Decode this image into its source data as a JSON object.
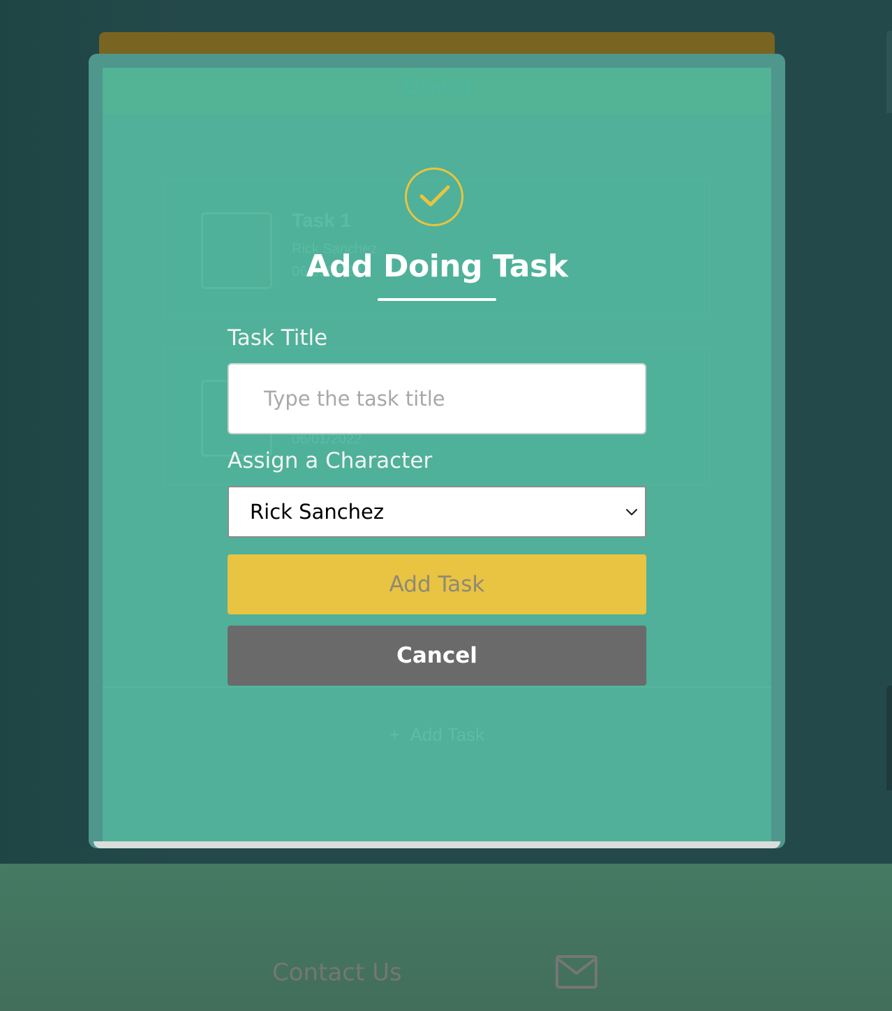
{
  "board": {
    "column_title": "Doing",
    "cards": [
      {
        "title": "Task 1",
        "character": "Rick Sanchez",
        "date": "06/01/2022"
      },
      {
        "title": "",
        "character": "",
        "date": "06/01/2022"
      }
    ],
    "add_task_label": "Add Task"
  },
  "modal": {
    "icon": "check-circle-icon",
    "title": "Add Doing Task",
    "task_title_label": "Task Title",
    "task_title_placeholder": "Type the task title",
    "task_title_value": "",
    "character_label": "Assign a Character",
    "character_selected": "Rick Sanchez",
    "add_button": "Add Task",
    "cancel_button": "Cancel"
  },
  "footer": {
    "contact_label": "Contact Us",
    "icon": "mail-icon"
  },
  "colors": {
    "accent_gold": "#e9c342",
    "modal_green": "#50b099",
    "cancel_gray": "#6a6a6a",
    "page_bg": "#24494a"
  }
}
